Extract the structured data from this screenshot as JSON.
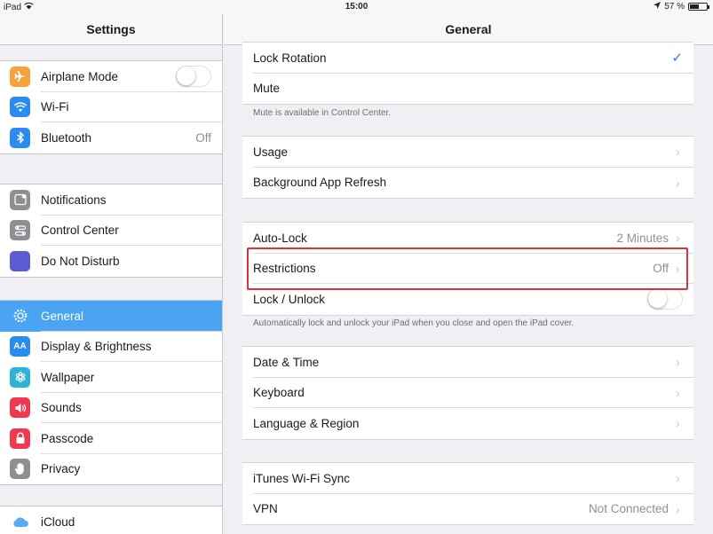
{
  "status_bar": {
    "device": "iPad",
    "time": "15:00",
    "battery": "57 %",
    "battery_level": 0.57
  },
  "sidebar": {
    "title": "Settings",
    "groups": [
      [
        {
          "label": "Airplane Mode",
          "icon": "airplane-icon",
          "color": "#f7a23a",
          "toggle": false
        },
        {
          "label": "Wi-Fi",
          "icon": "wifi-icon",
          "color": "#2a8cf0"
        },
        {
          "label": "Bluetooth",
          "icon": "bluetooth-icon",
          "color": "#2a8cf0",
          "value": "Off"
        }
      ],
      [
        {
          "label": "Notifications",
          "icon": "notifications-icon",
          "color": "#8e8e93"
        },
        {
          "label": "Control Center",
          "icon": "control-center-icon",
          "color": "#8e8e93"
        },
        {
          "label": "Do Not Disturb",
          "icon": "moon-icon",
          "color": "#5b5bd6"
        }
      ],
      [
        {
          "label": "General",
          "icon": "gear-icon",
          "color": "#8e8e93",
          "selected": true
        },
        {
          "label": "Display & Brightness",
          "icon": "display-icon",
          "color": "#2a8cf0"
        },
        {
          "label": "Wallpaper",
          "icon": "wallpaper-icon",
          "color": "#2fb3d4"
        },
        {
          "label": "Sounds",
          "icon": "speaker-icon",
          "color": "#f0384f"
        },
        {
          "label": "Passcode",
          "icon": "lock-icon",
          "color": "#f0384f"
        },
        {
          "label": "Privacy",
          "icon": "hand-icon",
          "color": "#8e8e93"
        }
      ],
      [
        {
          "label": "iCloud",
          "icon": "cloud-icon",
          "color": "#ffffff"
        }
      ]
    ]
  },
  "general": {
    "title": "General",
    "groups": [
      {
        "rows": [
          {
            "label": "Lock Rotation",
            "check": true
          },
          {
            "label": "Mute"
          }
        ],
        "footer": "Mute is available in Control Center."
      },
      {
        "rows": [
          {
            "label": "Usage",
            "chevron": true
          },
          {
            "label": "Background App Refresh",
            "chevron": true
          }
        ]
      },
      {
        "rows": [
          {
            "label": "Auto-Lock",
            "value": "2 Minutes",
            "chevron": true
          },
          {
            "label": "Restrictions",
            "value": "Off",
            "chevron": true
          },
          {
            "label": "Lock / Unlock",
            "toggle": false
          }
        ],
        "footer": "Automatically lock and unlock your iPad when you close and open the iPad cover."
      },
      {
        "rows": [
          {
            "label": "Date & Time",
            "chevron": true
          },
          {
            "label": "Keyboard",
            "chevron": true
          },
          {
            "label": "Language & Region",
            "chevron": true
          }
        ]
      },
      {
        "rows": [
          {
            "label": "iTunes Wi-Fi Sync",
            "chevron": true
          },
          {
            "label": "VPN",
            "value": "Not Connected",
            "chevron": true
          }
        ]
      }
    ]
  },
  "colors": {
    "accent": "#4aa3f3",
    "highlight_box": "#d9343a"
  }
}
